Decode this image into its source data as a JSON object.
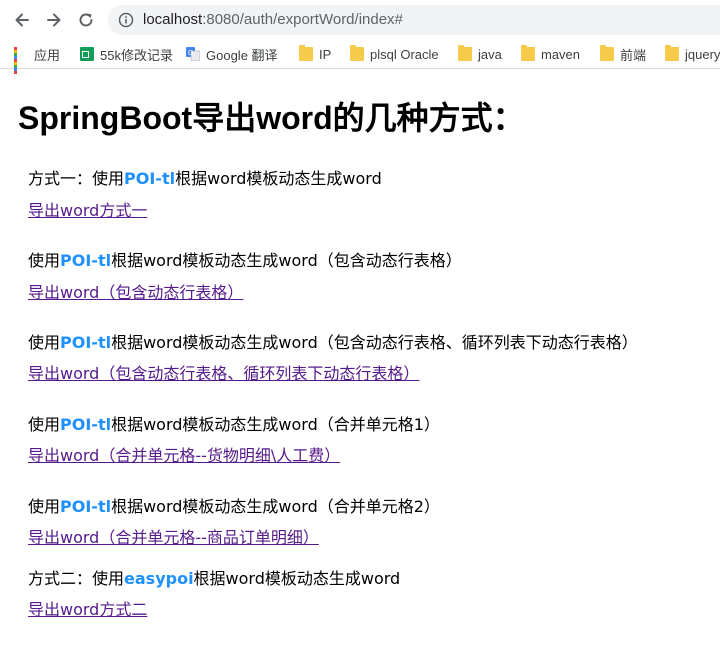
{
  "browser": {
    "url_host": "localhost",
    "url_path": ":8080/auth/exportWord/index#"
  },
  "bookmarks": [
    {
      "label": "应用",
      "icon": "apps-grid-icon"
    },
    {
      "label": "55k修改记录",
      "icon": "sheets-icon"
    },
    {
      "label": "Google 翻译",
      "icon": "google-translate-icon"
    },
    {
      "label": "IP",
      "icon": "folder-icon"
    },
    {
      "label": "plsql Oracle",
      "icon": "folder-icon"
    },
    {
      "label": "java",
      "icon": "folder-icon"
    },
    {
      "label": "maven",
      "icon": "folder-icon"
    },
    {
      "label": "前端",
      "icon": "folder-icon"
    },
    {
      "label": "jquery",
      "icon": "folder-icon"
    }
  ],
  "page": {
    "title": "SpringBoot导出word的几种方式：",
    "sections": [
      {
        "prefix": "方式一：使用",
        "highlight": "POI-tl",
        "suffix": "根据word模板动态生成word",
        "link": "导出word方式一"
      },
      {
        "prefix": "使用",
        "highlight": "POI-tl",
        "suffix": "根据word模板动态生成word（包含动态行表格）",
        "link": "导出word（包含动态行表格）"
      },
      {
        "prefix": "使用",
        "highlight": "POI-tl",
        "suffix": "根据word模板动态生成word（包含动态行表格、循环列表下动态行表格）",
        "link": "导出word（包含动态行表格、循环列表下动态行表格）"
      },
      {
        "prefix": "使用",
        "highlight": "POI-tl",
        "suffix": "根据word模板动态生成word（合并单元格1）",
        "link": "导出word（合并单元格--货物明细\\人工费）"
      },
      {
        "prefix": "使用",
        "highlight": "POI-tl",
        "suffix": "根据word模板动态生成word（合并单元格2）",
        "link": "导出word（合并单元格--商品订单明细）"
      },
      {
        "prefix": "方式二：使用",
        "highlight": "easypoi",
        "suffix": "根据word模板动态生成word",
        "link": "导出word方式二"
      }
    ]
  },
  "colors": {
    "highlight": "#1e90ff",
    "visited_link": "#551a8b"
  }
}
